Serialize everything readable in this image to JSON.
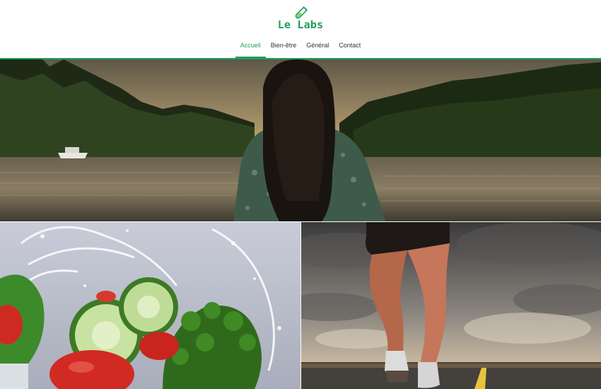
{
  "site": {
    "name": "Le Labs",
    "logo_icon": "test-tube-icon",
    "brand_color": "#1e9f5a"
  },
  "nav": {
    "items": [
      {
        "label": "Accueil",
        "active": true
      },
      {
        "label": "Bien-être",
        "active": false
      },
      {
        "label": "Général",
        "active": false
      },
      {
        "label": "Contact",
        "active": false
      }
    ]
  },
  "images": {
    "hero": "woman-by-lake-photo",
    "left_tile": "vegetables-water-splash-photo",
    "right_tile": "runner-legs-road-photo"
  }
}
